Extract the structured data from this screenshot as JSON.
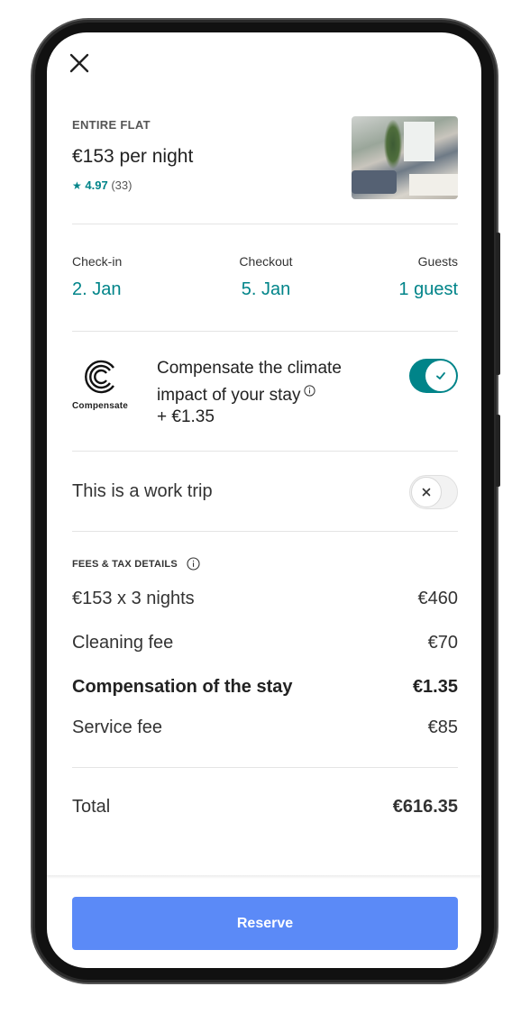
{
  "listing": {
    "type": "ENTIRE FLAT",
    "price": "€153 per night",
    "rating": "4.97",
    "reviews": "(33)"
  },
  "dates": {
    "checkin_label": "Check-in",
    "checkin_value": "2. Jan",
    "checkout_label": "Checkout",
    "checkout_value": "5. Jan",
    "guests_label": "Guests",
    "guests_value": "1 guest"
  },
  "climate": {
    "logo_text": "Compensate",
    "line1": "Compensate the climate",
    "line2": "impact of your stay",
    "price": "+ €1.35",
    "enabled": true
  },
  "work_trip": {
    "label": "This is a work trip",
    "enabled": false
  },
  "fees": {
    "header": "FEES & TAX DETAILS",
    "rows": [
      {
        "label": "€153 x 3 nights",
        "amount": "€460"
      },
      {
        "label": "Cleaning fee",
        "amount": "€70"
      },
      {
        "label": "Compensation of the stay",
        "amount": "€1.35"
      },
      {
        "label": "Service fee",
        "amount": "€85"
      }
    ],
    "total_label": "Total",
    "total_amount": "€616.35"
  },
  "reserve_label": "Reserve",
  "colors": {
    "accent": "#008489",
    "button": "#5b8af7"
  }
}
